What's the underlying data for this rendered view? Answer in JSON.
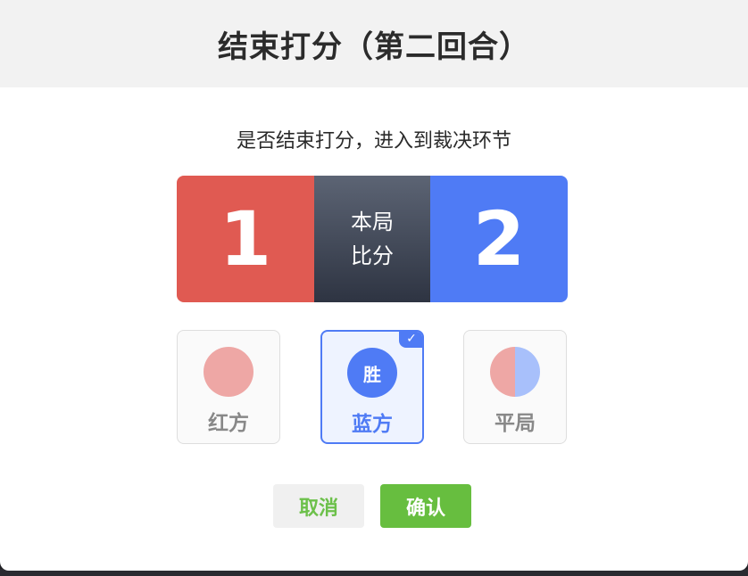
{
  "dialog": {
    "title": "结束打分（第二回合）",
    "prompt": "是否结束打分，进入到裁决环节"
  },
  "scoreboard": {
    "red_score": "1",
    "blue_score": "2",
    "caption_line1": "本局",
    "caption_line2": "比分"
  },
  "options": {
    "red": {
      "label": "红方"
    },
    "blue": {
      "label": "蓝方",
      "badge": "胜",
      "selected": true
    },
    "draw": {
      "label": "平局"
    }
  },
  "buttons": {
    "cancel": "取消",
    "confirm": "确认"
  },
  "colors": {
    "red": "#e05a52",
    "blue": "#4f7bf5",
    "green": "#67be3f"
  }
}
